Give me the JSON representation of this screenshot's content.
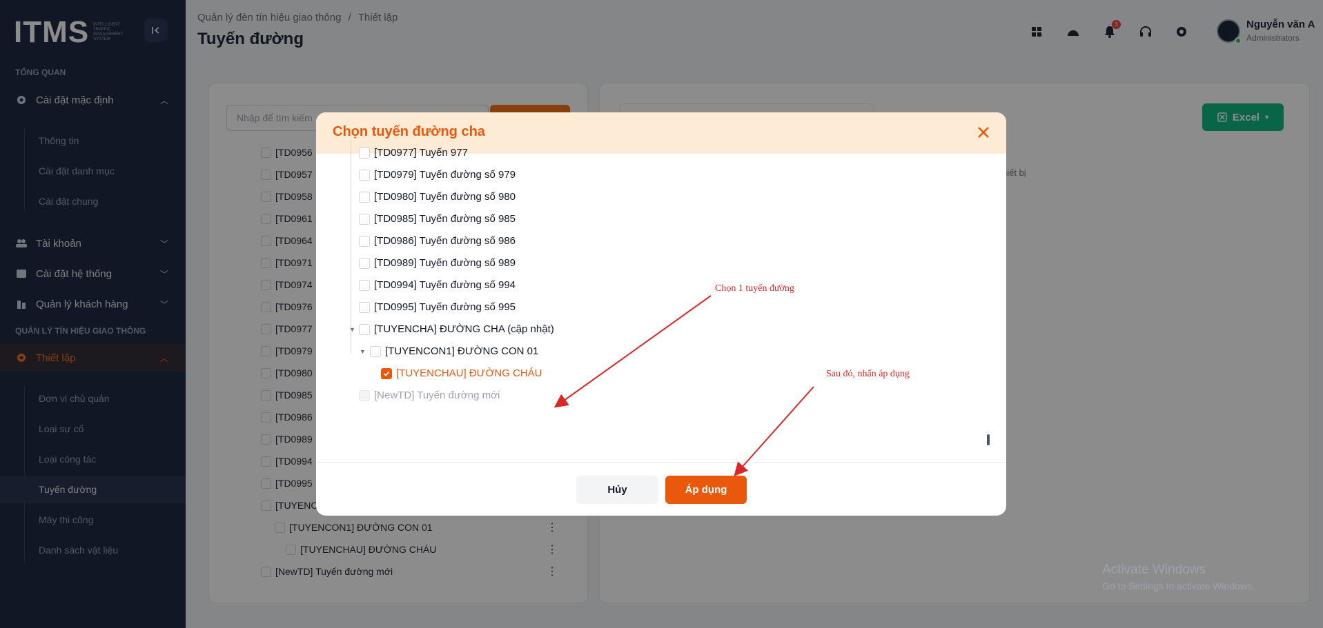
{
  "app": {
    "logo_text": "ITMS",
    "logo_sub": "INTELLIGENT TRAFFIC MANAGEMENT SYSTEM"
  },
  "sidebar": {
    "section_overview": "TỔNG QUAN",
    "default_settings": "Cài đặt mặc định",
    "default_sub": [
      "Thông tin",
      "Cài đặt danh mục",
      "Cài đặt chung"
    ],
    "account": "Tài khoản",
    "system_settings": "Cài đặt hệ thống",
    "customers": "Quản lý khách hàng",
    "section_traffic": "QUẢN LÝ TÍN HIỆU GIAO THÔNG",
    "setup": "Thiết lập",
    "setup_sub": [
      "Đơn vị chủ quản",
      "Loại sự cố",
      "Loại công tác",
      "Tuyến đường",
      "Máy thi công",
      "Danh sách vật liệu"
    ]
  },
  "header": {
    "breadcrumb_1": "Quản lý đèn tín hiệu giao thông",
    "breadcrumb_sep": "/",
    "breadcrumb_2": "Thiết lập",
    "title": "Tuyến đường",
    "notification_count": "3",
    "user_name": "Nguyễn văn A",
    "user_role": "Administrators"
  },
  "left_panel": {
    "search_placeholder": "Nhập để tìm kiếm",
    "rows": [
      "[TD0956",
      "[TD0957",
      "[TD0958",
      "[TD0961",
      "[TD0964",
      "[TD0971",
      "[TD0974",
      "[TD0976",
      "[TD0977",
      "[TD0979",
      "[TD0980",
      "[TD0985",
      "[TD0986",
      "[TD0989",
      "[TD0994",
      "[TD0995",
      "[TUYENC"
    ],
    "child1": "[TUYENCON1] ĐƯỜNG CON 01",
    "child2": "[TUYENCHAU] ĐƯỜNG CHÁU",
    "last": "[NewTD] Tuyến đường mới",
    "kebab": "⋮"
  },
  "right_panel": {
    "excel_label": "Excel",
    "note": "hiết bị"
  },
  "modal": {
    "title": "Chọn tuyến đường cha",
    "rows": [
      "[TD0977] Tuyến 977",
      "[TD0979] Tuyến đường số 979",
      "[TD0980] Tuyến đường số 980",
      "[TD0985] Tuyến đường số 985",
      "[TD0986] Tuyến đường số 986",
      "[TD0989] Tuyến đường số 989",
      "[TD0994] Tuyến đường số 994",
      "[TD0995] Tuyến đường số 995",
      "[TUYENCHA] ĐƯỜNG CHA (cập nhật)"
    ],
    "child1": "[TUYENCON1] ĐƯỜNG CON 01",
    "child2_checked": "[TUYENCHAU] ĐƯỜNG CHÁU",
    "disabled_row": "[NewTD] Tuyến đường mới",
    "cancel_label": "Hủy",
    "apply_label": "Áp dụng"
  },
  "annotations": {
    "a1": "Chọn 1 tuyến đường",
    "a2": "Sau đó, nhấn áp dụng"
  },
  "windows": {
    "line1": "Activate Windows",
    "line2": "Go to Settings to activate Windows."
  },
  "colors": {
    "accent": "#ea580c",
    "sidebar_bg": "#1f2a44",
    "annotation": "#dc2626"
  }
}
